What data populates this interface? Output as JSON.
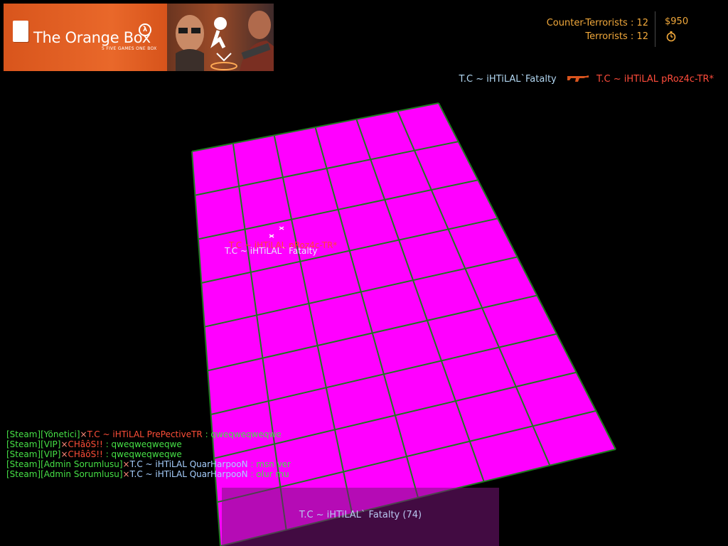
{
  "banner": {
    "title": "The Orange Box",
    "subtitle": "5 FIVE GAMES ONE BOX"
  },
  "scoreboard": {
    "ct_label": "Counter-Terrorists : 12",
    "t_label": "Terrorists : 12",
    "money": "$950"
  },
  "killfeed": {
    "attacker": "T.C ~ iHTiLAL`Fatalty",
    "weapon_icon": "rifle-icon",
    "victim": "T.C ~ iHTiLAL  pRoz4c-TR*"
  },
  "name_tags": {
    "red": "T.C ~ iHTiLAL  pRoz4c-TR*",
    "blue": "T.C ~ iHTiLAL` Fatalty"
  },
  "chat": [
    {
      "prefix": "[Steam][Yönetici]",
      "sep": "×",
      "name": "T.C ~ iHTiLAL PrePectiveTR",
      "msg": " : qweqweqweqwe",
      "name_color": "red"
    },
    {
      "prefix": "[Steam][VIP]",
      "sep": "×",
      "name": "CHâôS!!",
      "msg": " : qweqweqweqwe",
      "name_color": "red"
    },
    {
      "prefix": "[Steam][VIP]",
      "sep": "×",
      "name": "CHâôS!!",
      "msg": " : qweqweqweqwe",
      "name_color": "red"
    },
    {
      "prefix": "[Steam][Admin Sorumlusu]",
      "sep": "×",
      "name": "T.C ~ iHTiLAL QuarHarpooN",
      "msg": " : msn ver",
      "name_color": "blue"
    },
    {
      "prefix": "[Steam][Admin Sorumlusu]",
      "sep": "×",
      "name": "T.C ~ iHTiLAL QuarHarpooN",
      "msg": " : olur mu",
      "name_color": "blue"
    }
  ],
  "spectator": {
    "target": "T.C ~ iHTiLAL` Fatalty (74)"
  },
  "colors": {
    "floor": "#ff00ff",
    "grid_lines": "#1e7a1e",
    "hud_orange": "#f2a93b"
  }
}
